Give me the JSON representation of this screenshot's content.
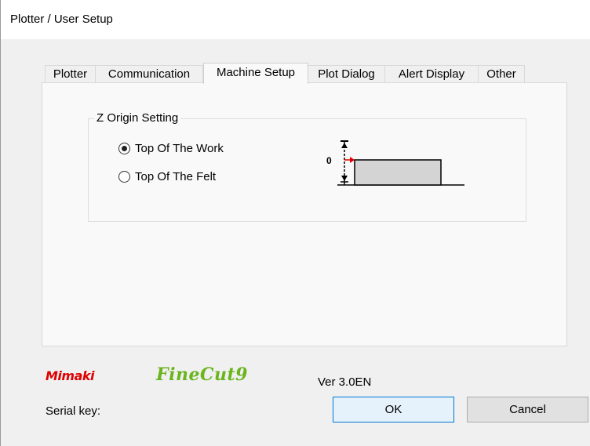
{
  "window": {
    "title": "Plotter / User Setup"
  },
  "tabs": [
    {
      "label": "Plotter"
    },
    {
      "label": "Communication"
    },
    {
      "label": "Machine Setup",
      "active": true
    },
    {
      "label": "Plot Dialog"
    },
    {
      "label": "Alert Display"
    },
    {
      "label": "Other"
    }
  ],
  "z_origin": {
    "legend": "Z Origin Setting",
    "options": [
      {
        "label": "Top Of The Work",
        "checked": true
      },
      {
        "label": "Top Of The Felt",
        "checked": false
      }
    ],
    "diagram_zero_label": "0"
  },
  "footer": {
    "brand_mimaki": "Mimaki",
    "brand_finecut": "FineCut9",
    "version": "Ver 3.0EN",
    "serial_label": "Serial key:",
    "ok_label": "OK",
    "cancel_label": "Cancel"
  },
  "colors": {
    "mimaki_red": "#e00000",
    "finecut_green": "#6ab41e",
    "accent_blue": "#0078d7"
  }
}
